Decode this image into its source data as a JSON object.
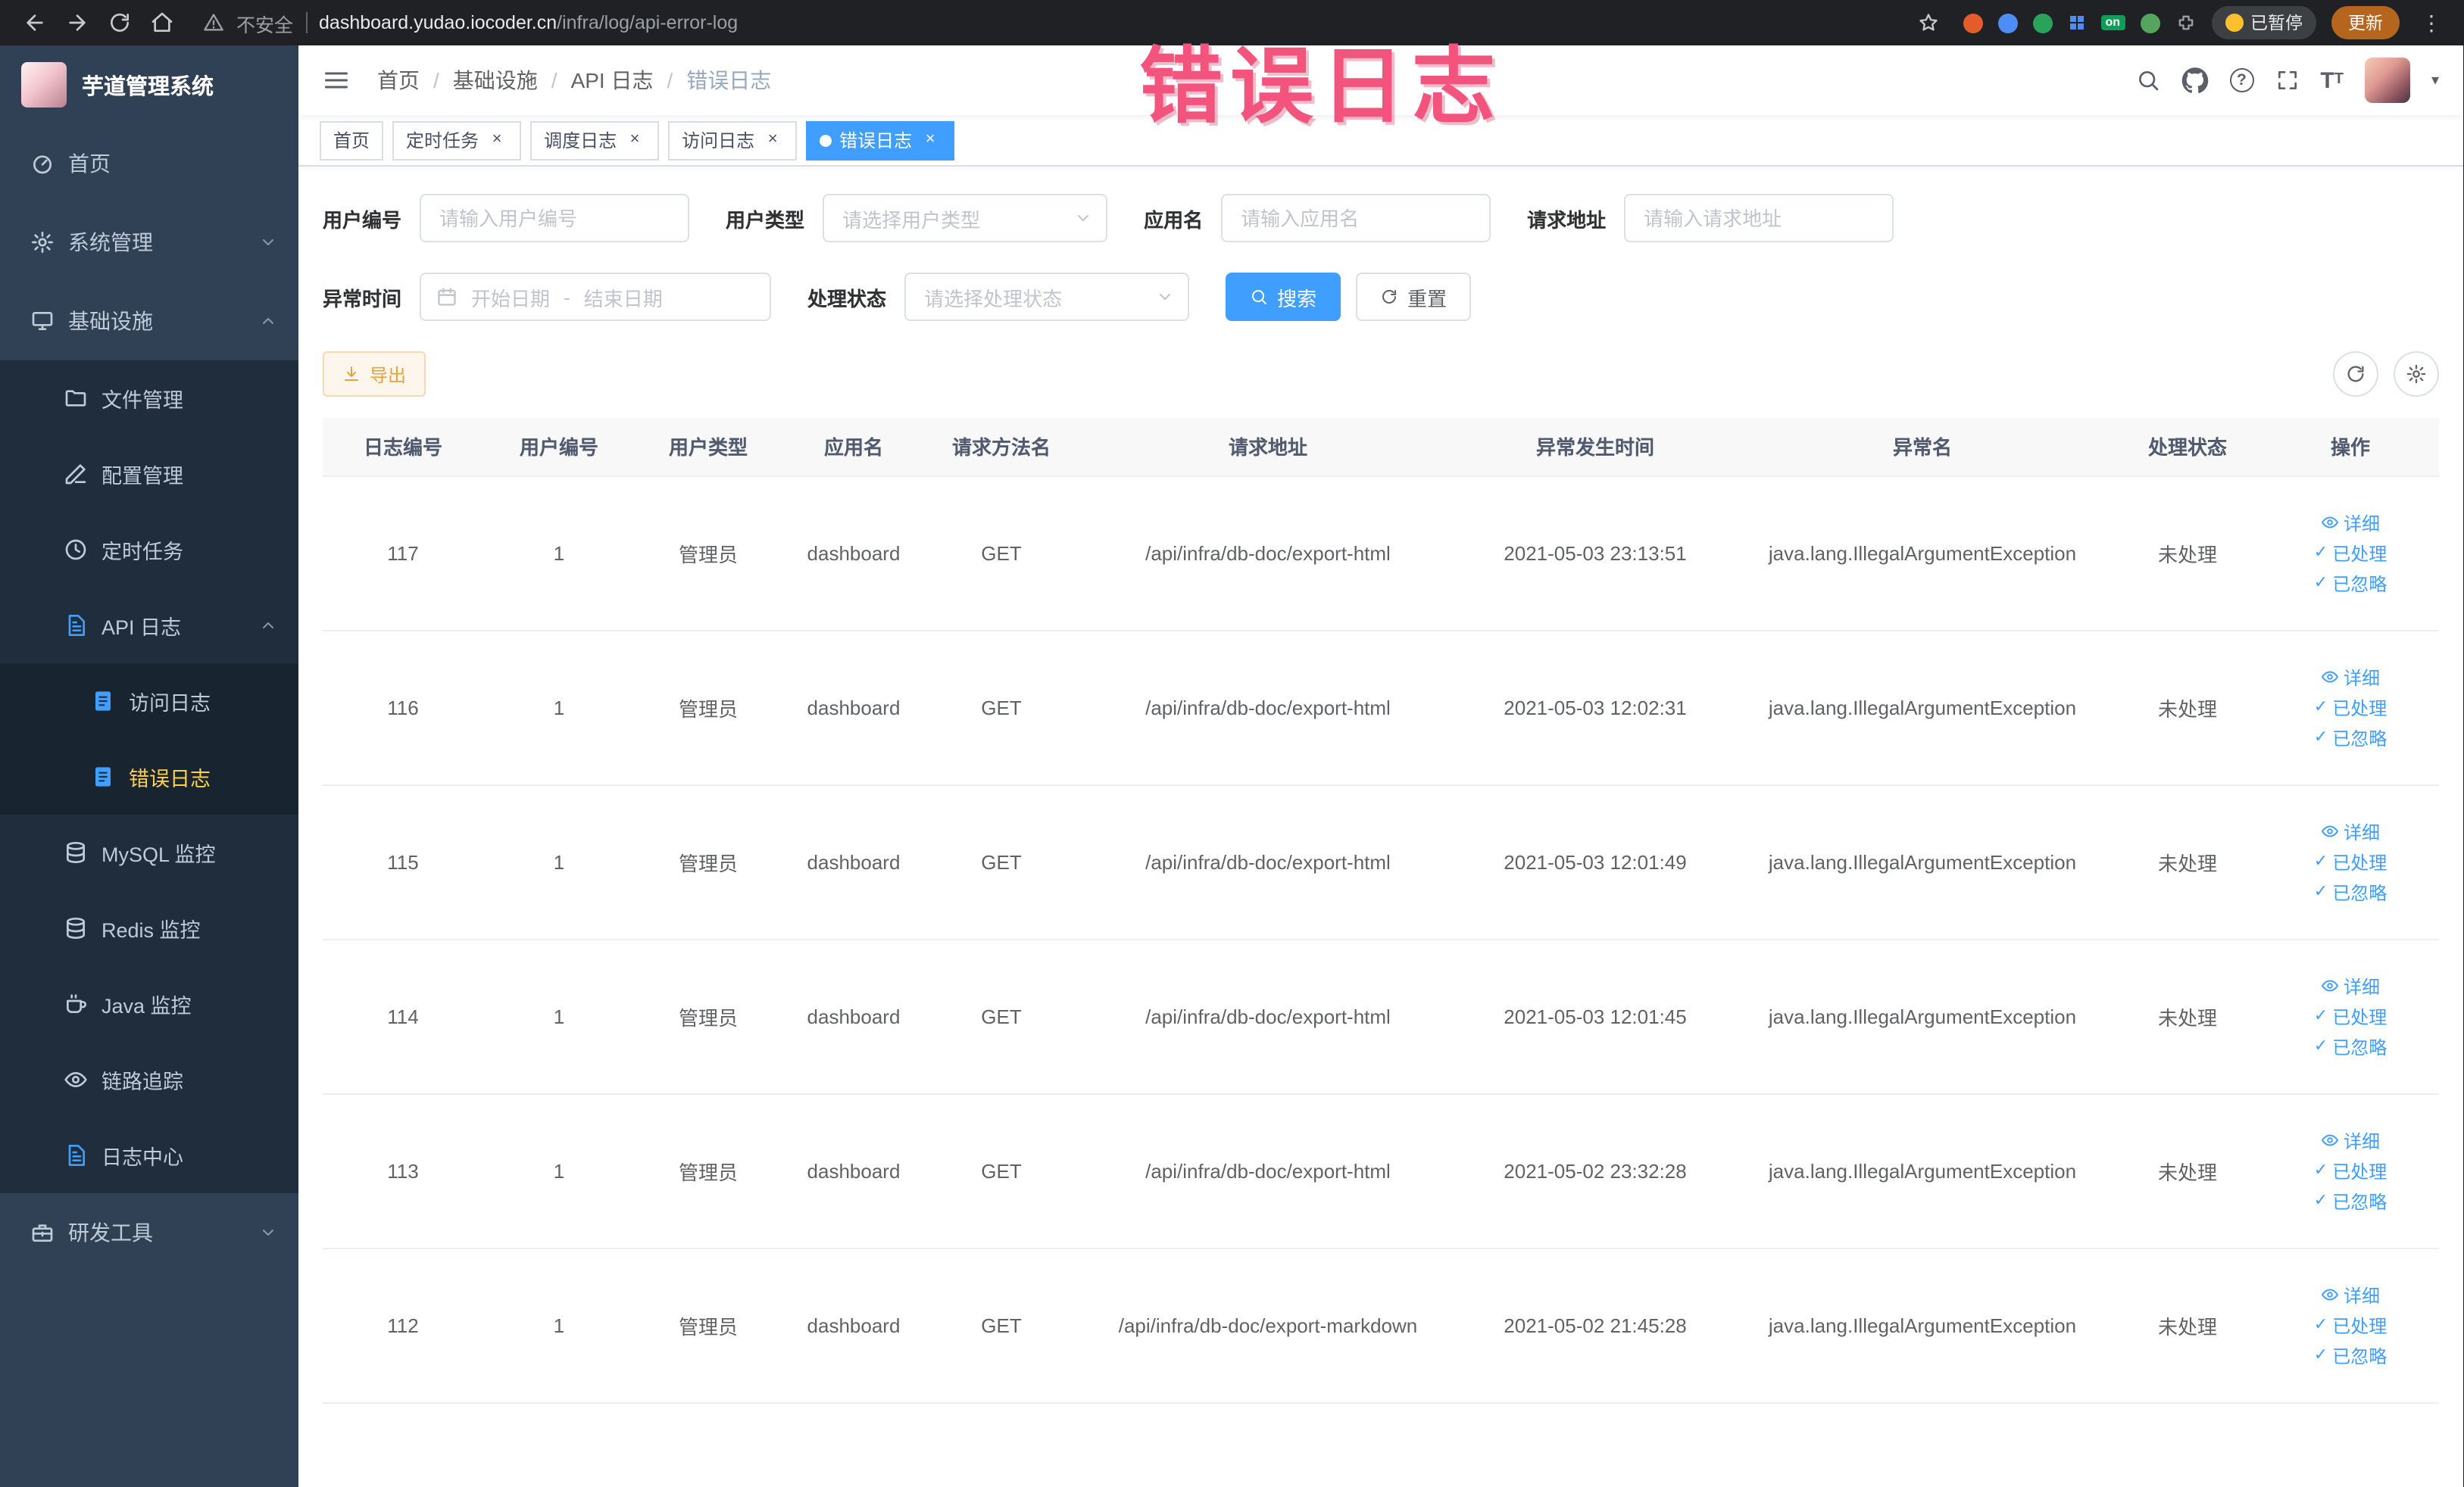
{
  "browser": {
    "security_label": "不安全",
    "url_host": "dashboard.yudao.iocoder.cn",
    "url_path": "/infra/log/api-error-log",
    "on_badge": "on",
    "paused_label": "已暂停",
    "update_label": "更新"
  },
  "annotation": {
    "text": "错误日志"
  },
  "sidebar": {
    "logo_title": "芋道管理系统",
    "items": [
      {
        "label": "首页"
      },
      {
        "label": "系统管理"
      },
      {
        "label": "基础设施"
      },
      {
        "label": "文件管理"
      },
      {
        "label": "配置管理"
      },
      {
        "label": "定时任务"
      },
      {
        "label": "API 日志"
      },
      {
        "label": "访问日志"
      },
      {
        "label": "错误日志"
      },
      {
        "label": "MySQL 监控"
      },
      {
        "label": "Redis 监控"
      },
      {
        "label": "Java 监控"
      },
      {
        "label": "链路追踪"
      },
      {
        "label": "日志中心"
      },
      {
        "label": "研发工具"
      }
    ]
  },
  "header": {
    "breadcrumb": [
      "首页",
      "基础设施",
      "API 日志",
      "错误日志"
    ]
  },
  "tabs": [
    {
      "label": "首页"
    },
    {
      "label": "定时任务"
    },
    {
      "label": "调度日志"
    },
    {
      "label": "访问日志"
    },
    {
      "label": "错误日志"
    }
  ],
  "filters": {
    "user_id": {
      "label": "用户编号",
      "placeholder": "请输入用户编号"
    },
    "user_type": {
      "label": "用户类型",
      "placeholder": "请选择用户类型"
    },
    "app_name": {
      "label": "应用名",
      "placeholder": "请输入应用名"
    },
    "request_url": {
      "label": "请求地址",
      "placeholder": "请输入请求地址"
    },
    "exception_time": {
      "label": "异常时间",
      "start_placeholder": "开始日期",
      "separator": "-",
      "end_placeholder": "结束日期"
    },
    "process_status": {
      "label": "处理状态",
      "placeholder": "请选择处理状态"
    },
    "search_label": "搜索",
    "reset_label": "重置"
  },
  "toolbar": {
    "export_label": "导出"
  },
  "table": {
    "columns": [
      "日志编号",
      "用户编号",
      "用户类型",
      "应用名",
      "请求方法名",
      "请求地址",
      "异常发生时间",
      "异常名",
      "处理状态",
      "操作"
    ],
    "action_labels": {
      "detail": "详细",
      "processed": "已处理",
      "ignored": "已忽略"
    },
    "rows": [
      {
        "id": "117",
        "user_id": "1",
        "user_type": "管理员",
        "app": "dashboard",
        "method": "GET",
        "url": "/api/infra/db-doc/export-html",
        "time": "2021-05-03 23:13:51",
        "exception": "java.lang.IllegalArgumentException",
        "status": "未处理"
      },
      {
        "id": "116",
        "user_id": "1",
        "user_type": "管理员",
        "app": "dashboard",
        "method": "GET",
        "url": "/api/infra/db-doc/export-html",
        "time": "2021-05-03 12:02:31",
        "exception": "java.lang.IllegalArgumentException",
        "status": "未处理"
      },
      {
        "id": "115",
        "user_id": "1",
        "user_type": "管理员",
        "app": "dashboard",
        "method": "GET",
        "url": "/api/infra/db-doc/export-html",
        "time": "2021-05-03 12:01:49",
        "exception": "java.lang.IllegalArgumentException",
        "status": "未处理"
      },
      {
        "id": "114",
        "user_id": "1",
        "user_type": "管理员",
        "app": "dashboard",
        "method": "GET",
        "url": "/api/infra/db-doc/export-html",
        "time": "2021-05-03 12:01:45",
        "exception": "java.lang.IllegalArgumentException",
        "status": "未处理"
      },
      {
        "id": "113",
        "user_id": "1",
        "user_type": "管理员",
        "app": "dashboard",
        "method": "GET",
        "url": "/api/infra/db-doc/export-html",
        "time": "2021-05-02 23:32:28",
        "exception": "java.lang.IllegalArgumentException",
        "status": "未处理"
      },
      {
        "id": "112",
        "user_id": "1",
        "user_type": "管理员",
        "app": "dashboard",
        "method": "GET",
        "url": "/api/infra/db-doc/export-markdown",
        "time": "2021-05-02 21:45:28",
        "exception": "java.lang.IllegalArgumentException",
        "status": "未处理"
      }
    ]
  }
}
